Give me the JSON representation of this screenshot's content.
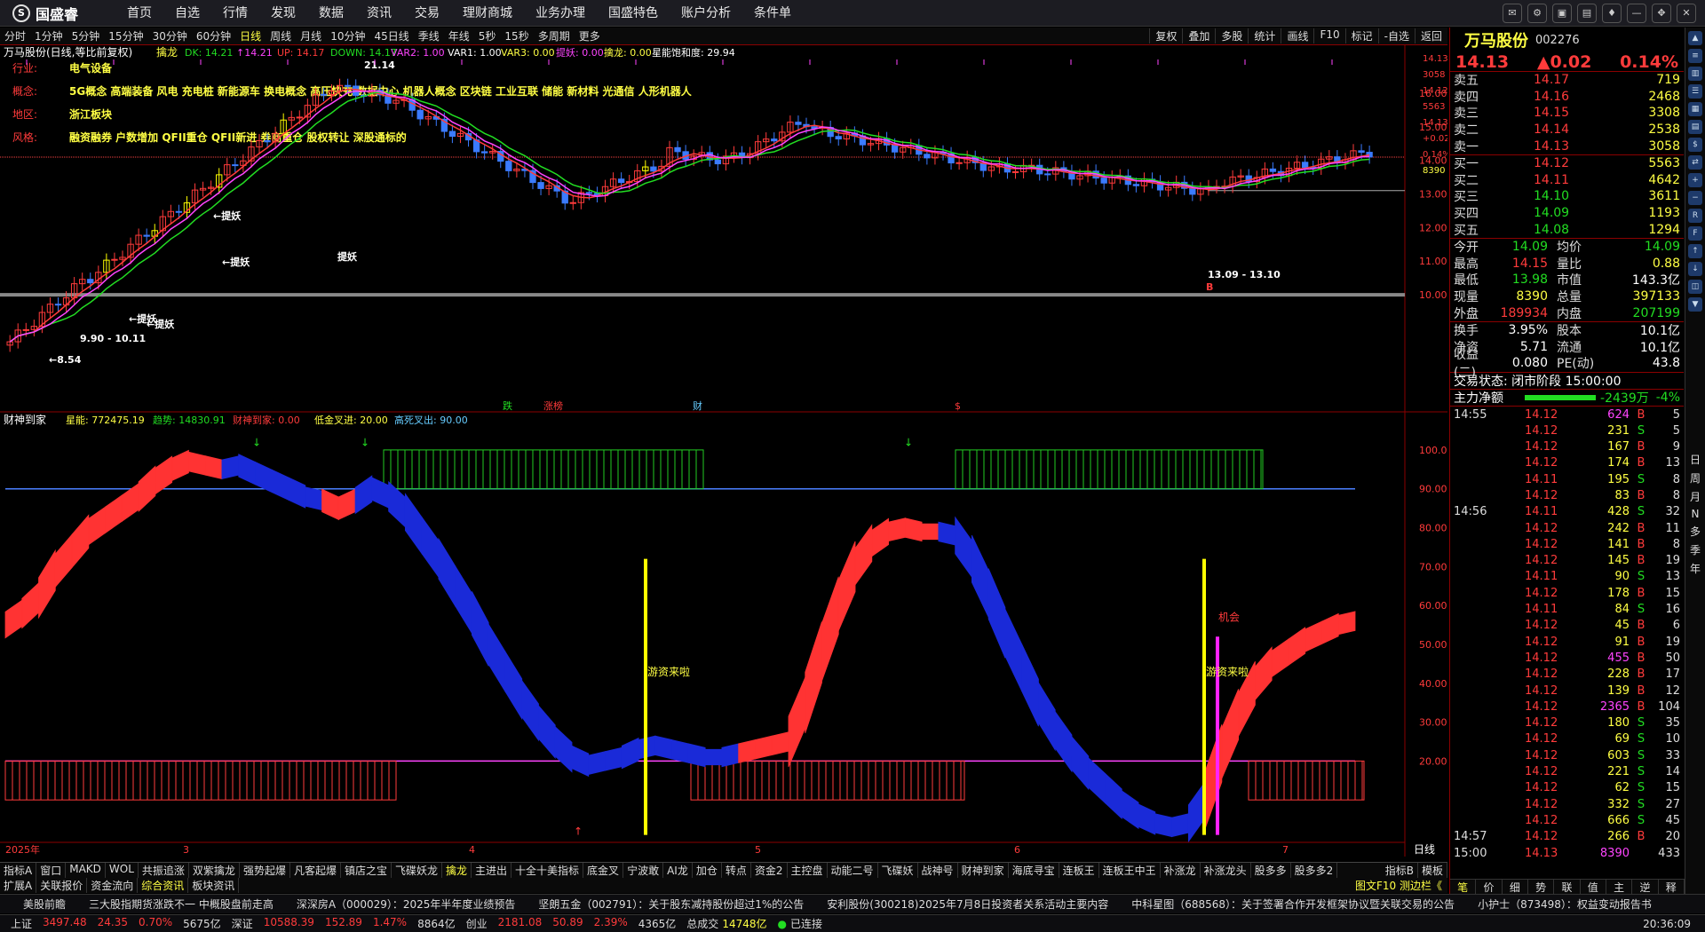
{
  "app": {
    "logo": "国盛睿",
    "nav": [
      "首页",
      "自选",
      "行情",
      "发现",
      "数据",
      "资讯",
      "交易",
      "理财商城",
      "业务办理",
      "国盛特色",
      "账户分析",
      "条件单"
    ]
  },
  "periods": [
    "分时",
    "1分钟",
    "5分钟",
    "15分钟",
    "30分钟",
    "60分钟",
    "日线",
    "周线",
    "月线",
    "10分钟",
    "45日线",
    "季线",
    "年线",
    "5秒",
    "15秒",
    "多周期",
    "更多"
  ],
  "active_period": "日线",
  "tools": [
    "复权",
    "叠加",
    "多股",
    "统计",
    "画线",
    "F10",
    "标记",
    "-自选",
    "返回"
  ],
  "main_header": {
    "title": "万马股份(日线,等比前复权)",
    "ind": "擒龙",
    "items": [
      {
        "t": "DK: 14.21",
        "c": "#22dd22"
      },
      {
        "t": "↑14.21",
        "c": "#ff44ff"
      },
      {
        "t": "UP: 14.17",
        "c": "#ff3b3b"
      },
      {
        "t": "DOWN: 14.17",
        "c": "#22dd22"
      },
      {
        "t": "VAR2: 1.00",
        "c": "#ff44ff"
      },
      {
        "t": "VAR1: 1.00",
        "c": "#ffffff"
      },
      {
        "t": "VAR3: 0.00",
        "c": "#ffff44"
      },
      {
        "t": "提妖: 0.00",
        "c": "#ff44ff"
      },
      {
        "t": "擒龙: 0.00",
        "c": "#ffff44"
      },
      {
        "t": "星能饱和度: 29.94",
        "c": "#ffffff"
      }
    ]
  },
  "info_rows": [
    {
      "label": "行业:",
      "value": "电气设备"
    },
    {
      "label": "概念:",
      "value": "5G概念 高端装备 风电 充电桩 新能源车 换电概念 高压快充 数据中心 机器人概念 区块链 工业互联 储能 新材料 光通信 人形机器人"
    },
    {
      "label": "地区:",
      "value": "浙江板块"
    },
    {
      "label": "风格:",
      "value": "融资融券 户数增加 QFII重仓 QFII新进 券商重仓 股权转让 深股通标的"
    }
  ],
  "chart_data": {
    "type": "candlestick",
    "main_axis": {
      "ticks": [
        "16.00",
        "15.00",
        "14.00",
        "13.00",
        "12.00",
        "11.00",
        "10.00"
      ],
      "ylim": [
        9.5,
        16.9
      ]
    },
    "right_labels": [
      "14.13",
      "3058",
      "14.12",
      "5563",
      "14.13",
      "+0.02",
      "0.14%",
      "8390"
    ],
    "annotations": [
      "21.14",
      "提妖",
      "←提妖",
      "←提妖",
      "←提妖",
      "←提妖",
      "9.90 - 10.11",
      "←8.54",
      "13.09 - 13.10",
      "B"
    ],
    "event_marks": [
      {
        "t": "跌",
        "c": "#22dd22"
      },
      {
        "t": "涨榜",
        "c": "#ff3b3b"
      },
      {
        "t": "财",
        "c": "#66ccff"
      },
      {
        "t": "$",
        "c": "#ff3b3b"
      }
    ],
    "sub_header": {
      "name": "财神到家",
      "items": [
        {
          "t": "星能: 772475.19",
          "c": "#ffff44"
        },
        {
          "t": "趋势: 14830.91",
          "c": "#22dd22"
        },
        {
          "t": "财神到家: 0.00",
          "c": "#ff3b3b"
        },
        {
          "t": "低金叉进: 20.00",
          "c": "#ffff44"
        },
        {
          "t": "高死叉出: 90.00",
          "c": "#66ccff"
        }
      ]
    },
    "sub_axis": {
      "ticks": [
        "100.00",
        "90.00",
        "80.00",
        "70.00",
        "60.00",
        "50.00",
        "40.00",
        "30.00",
        "20.00"
      ],
      "ylim": [
        0,
        105
      ]
    },
    "sub_labels": [
      "游资来啦",
      "游资来啦",
      "机会"
    ],
    "x_ticks": [
      "2025年",
      "3",
      "4",
      "5",
      "6",
      "7"
    ],
    "corner_label": "日线",
    "trend_series": [
      55,
      58,
      62,
      69,
      74,
      79,
      82,
      85,
      88,
      92,
      95,
      97,
      96,
      95,
      96,
      94,
      92,
      90,
      88,
      87,
      85,
      87,
      90,
      88,
      84,
      78,
      72,
      65,
      58,
      50,
      43,
      36,
      30,
      25,
      21,
      19,
      20,
      21,
      23,
      24,
      23,
      22,
      21,
      21,
      22,
      23,
      24,
      25,
      35,
      48,
      60,
      70,
      76,
      79,
      80,
      79,
      79,
      78,
      72,
      63,
      53,
      44,
      35,
      28,
      22,
      17,
      13,
      9,
      6,
      4,
      3,
      4,
      10,
      22,
      32,
      40,
      45,
      48,
      51,
      53,
      55,
      56
    ],
    "trend_colors": "rrrrrrrrrrrrrbbbbbbrrbbbbbbbbbbbbbbbbbbbbbbbrrrrrrrrrrrrbbbbbbbbbbbbbbbbrrrrrrrrr"
  },
  "ind_tabs": [
    "指标A",
    "窗口",
    "MAKD",
    "WOL",
    "共振追涨",
    "双紫擒龙",
    "强势起爆",
    "凡客起爆",
    "镇店之宝",
    "飞碟妖龙",
    "擒龙",
    "主进出",
    "十全十美指标",
    "底金叉",
    "宁波敢",
    "AI龙",
    "加仓",
    "转点",
    "资金2",
    "主控盘",
    "动能二号",
    "飞碟妖",
    "战神号",
    "财神到家",
    "海底寻宝",
    "连板王",
    "连板王中王",
    "补涨龙",
    "补涨龙头",
    "股多多",
    "股多多2"
  ],
  "active_ind": "擒龙",
  "ind_extra": [
    "指标B",
    "模板"
  ],
  "bottom_tabs": [
    "扩展A",
    "关联报价",
    "资金流向",
    "综合资讯",
    "板块资讯"
  ],
  "active_tab": "综合资讯",
  "bottom_right_text": "图文F10 测边栏《",
  "ticker": [
    "美股前瞻",
    "三大股指期货涨跌不一 中概股盘前走高",
    "深深房A（000029）：2025年半年度业绩预告",
    "坚朗五金（002791）：关于股东减持股份超过1%的公告",
    "安利股份(300218)2025年7月8日投资者关系活动主要内容",
    "中科星图（688568）：关于签署合作开发框架协议暨关联交易的公告",
    "小护士（873498）：权益变动报告书"
  ],
  "status": [
    {
      "l": "上证",
      "v": "3497.48",
      "d": "24.35",
      "p": "0.70%",
      "a": "5675亿"
    },
    {
      "l": "深证",
      "v": "10588.39",
      "d": "152.89",
      "p": "1.47%",
      "a": "8864亿"
    },
    {
      "l": "创业",
      "v": "2181.08",
      "d": "50.89",
      "p": "2.39%",
      "a": "4365亿"
    }
  ],
  "total_label": "总成交",
  "total_value": "14748亿",
  "connected": "已连接",
  "clock": "20:36:09",
  "stock": {
    "name": "万马股份",
    "code": "002276",
    "price": "14.13",
    "change": "▲0.02",
    "pct": "0.14%",
    "asks": [
      {
        "l": "卖五",
        "p": "14.17",
        "v": "719"
      },
      {
        "l": "卖四",
        "p": "14.16",
        "v": "2468"
      },
      {
        "l": "卖三",
        "p": "14.15",
        "v": "3308"
      },
      {
        "l": "卖二",
        "p": "14.14",
        "v": "2538"
      },
      {
        "l": "卖一",
        "p": "14.13",
        "v": "3058"
      }
    ],
    "bids": [
      {
        "l": "买一",
        "p": "14.12",
        "v": "5563",
        "pc": "#ff3b3b"
      },
      {
        "l": "买二",
        "p": "14.11",
        "v": "4642",
        "pc": "#ff3b3b"
      },
      {
        "l": "买三",
        "p": "14.10",
        "v": "3611",
        "pc": "#22dd22"
      },
      {
        "l": "买四",
        "p": "14.09",
        "v": "1193",
        "pc": "#22dd22"
      },
      {
        "l": "买五",
        "p": "14.08",
        "v": "1294",
        "pc": "#22dd22"
      }
    ],
    "stats": [
      [
        "今开",
        "14.09",
        "#22dd22",
        "均价",
        "14.09",
        "#22dd22"
      ],
      [
        "最高",
        "14.15",
        "#ff3b3b",
        "量比",
        "0.88",
        "#ffff44"
      ],
      [
        "最低",
        "13.98",
        "#22dd22",
        "市值",
        "143.3亿",
        "#ffffff"
      ],
      [
        "现量",
        "8390",
        "#ffff44",
        "总量",
        "397133",
        "#ffff44"
      ],
      [
        "外盘",
        "189934",
        "#ff3b3b",
        "内盘",
        "207199",
        "#22dd22"
      ]
    ],
    "stats2": [
      [
        "换手",
        "3.95%",
        "#ffffff",
        "股本",
        "10.1亿",
        "#ffffff"
      ],
      [
        "净资",
        "5.71",
        "#ffffff",
        "流通",
        "10.1亿",
        "#ffffff"
      ],
      [
        "收益(二)",
        "0.080",
        "#ffffff",
        "PE(动)",
        "43.8",
        "#ffffff"
      ]
    ],
    "trade_state": "交易状态: 闭市阶段 15:00:00",
    "net_label": "主力净额",
    "net_value": "-2439万",
    "net_pct": "-4%",
    "trades": [
      [
        "14:55",
        "14.12",
        "624",
        "B",
        "5"
      ],
      [
        "",
        "14.12",
        "231",
        "S",
        "5"
      ],
      [
        "",
        "14.12",
        "167",
        "B",
        "9"
      ],
      [
        "",
        "14.12",
        "174",
        "B",
        "13"
      ],
      [
        "",
        "14.11",
        "195",
        "S",
        "8"
      ],
      [
        "",
        "14.12",
        "83",
        "B",
        "8"
      ],
      [
        "14:56",
        "14.11",
        "428",
        "S",
        "32"
      ],
      [
        "",
        "14.12",
        "242",
        "B",
        "11"
      ],
      [
        "",
        "14.12",
        "141",
        "B",
        "8"
      ],
      [
        "",
        "14.12",
        "145",
        "B",
        "19"
      ],
      [
        "",
        "14.11",
        "90",
        "S",
        "13"
      ],
      [
        "",
        "14.12",
        "178",
        "B",
        "15"
      ],
      [
        "",
        "14.11",
        "84",
        "S",
        "16"
      ],
      [
        "",
        "14.12",
        "45",
        "B",
        "6"
      ],
      [
        "",
        "14.12",
        "91",
        "B",
        "19"
      ],
      [
        "",
        "14.12",
        "455",
        "B",
        "50"
      ],
      [
        "",
        "14.12",
        "228",
        "B",
        "17"
      ],
      [
        "",
        "14.12",
        "139",
        "B",
        "12"
      ],
      [
        "",
        "14.12",
        "2365",
        "B",
        "104"
      ],
      [
        "",
        "14.12",
        "180",
        "S",
        "35"
      ],
      [
        "",
        "14.12",
        "69",
        "S",
        "10"
      ],
      [
        "",
        "14.12",
        "603",
        "S",
        "33"
      ],
      [
        "",
        "14.12",
        "221",
        "S",
        "14"
      ],
      [
        "",
        "14.12",
        "62",
        "S",
        "15"
      ],
      [
        "",
        "14.12",
        "332",
        "S",
        "27"
      ],
      [
        "",
        "14.12",
        "666",
        "S",
        "45"
      ],
      [
        "14:57",
        "14.12",
        "266",
        "B",
        "20"
      ],
      [
        "15:00",
        "14.13",
        "8390",
        "",
        "433"
      ]
    ],
    "bottom_tabs": [
      "笔",
      "价",
      "细",
      "势",
      "联",
      "值",
      "主",
      "逆",
      "释"
    ]
  },
  "sidebar_chars": [
    "日",
    "周",
    "月",
    "N",
    "多",
    "季",
    "年"
  ]
}
